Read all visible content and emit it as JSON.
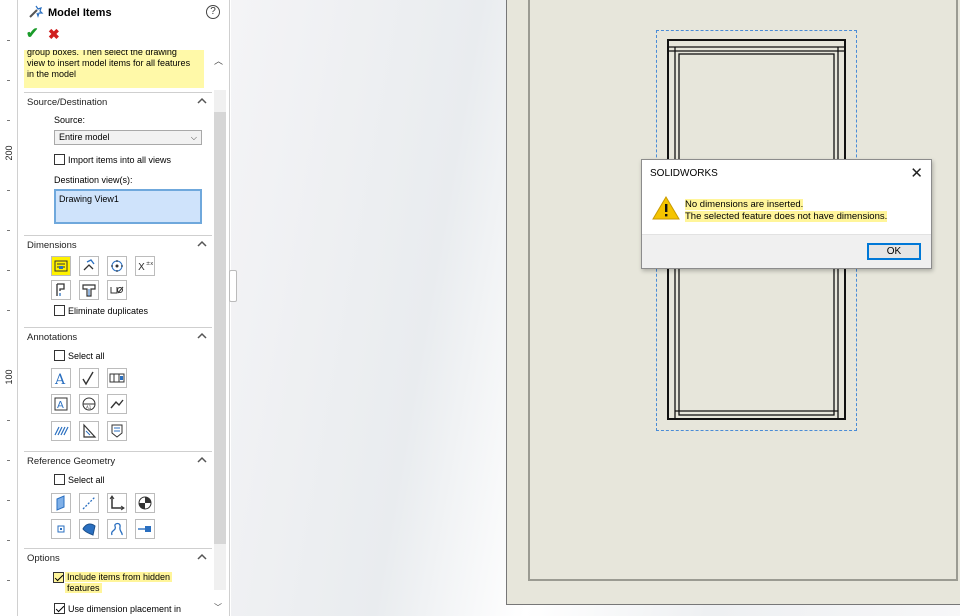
{
  "ruler": {
    "labels": [
      "200",
      "100"
    ]
  },
  "panel": {
    "title": "Model Items",
    "message_lines": [
      "group boxes. Then select the drawing",
      "view  to insert model items for all features",
      "in the model"
    ],
    "source_destination": {
      "title": "Source/Destination",
      "source_label": "Source:",
      "source_value": "Entire model",
      "import_label": "Import items into all views",
      "import_checked": false,
      "destination_label": "Destination view(s):",
      "destination_value": "Drawing View1"
    },
    "dimensions": {
      "title": "Dimensions",
      "icons": [
        "marked-for-drawing-icon",
        "not-marked-for-drawing-icon",
        "instance-counts-icon",
        "tolerance-dimensions-icon",
        "hole-wizard-profiles-icon",
        "hole-wizard-locations-icon",
        "hole-callout-icon"
      ],
      "eliminate_label": "Eliminate duplicates",
      "eliminate_checked": false
    },
    "annotations": {
      "title": "Annotations",
      "select_all_label": "Select all",
      "icons": [
        "note-icon",
        "surface-finish-icon",
        "datum-target-icon",
        "balloon-icon",
        "datum-feature-icon",
        "weld-symbol-icon",
        "cosmetic-thread-icon",
        "geometric-tolerance-icon",
        "caterpillar-icon"
      ]
    },
    "reference_geometry": {
      "title": "Reference Geometry",
      "select_all_label": "Select all",
      "icons": [
        "plane-icon",
        "axis-icon",
        "origin-icon",
        "center-of-mass-icon",
        "point-icon",
        "surface-icon",
        "curve-icon",
        "route-point-icon"
      ]
    },
    "options": {
      "title": "Options",
      "hidden_features_label_1": "Include items from hidden",
      "hidden_features_label_2": "features",
      "hidden_features_checked": true,
      "placement_label": "Use dimension placement in",
      "placement_checked": true
    }
  },
  "dialog": {
    "title": "SOLIDWORKS",
    "message_1": "No dimensions are inserted.",
    "message_2": "The selected feature does not have dimensions.",
    "ok_label": "OK"
  },
  "colors": {
    "highlight": "#fff59a",
    "accept": "#1a9b2a",
    "cancel": "#d02020",
    "selection": "#cfe3fb"
  }
}
